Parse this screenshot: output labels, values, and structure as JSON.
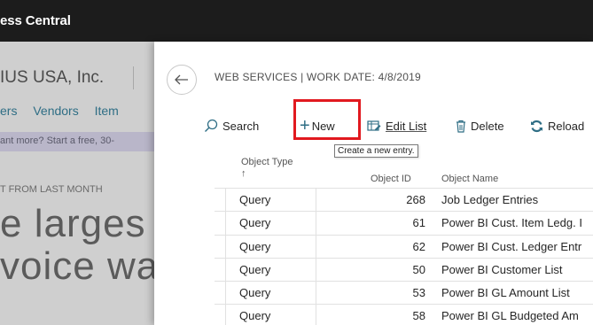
{
  "app": {
    "title": "ess Central"
  },
  "background": {
    "company": "IUS USA, Inc.",
    "nav_links": [
      "ers",
      "Vendors",
      "Item"
    ],
    "trial_banner": "ant more? Start a free, 30-",
    "kpi_label": "T FROM LAST MONTH",
    "big_text_line1": "e larges",
    "big_text_line2": "voice wa"
  },
  "panel": {
    "back_icon": "back-arrow-icon",
    "breadcrumb": "WEB SERVICES | WORK DATE: 4/8/2019",
    "toolbar": {
      "search_label": "Search",
      "new_label": "New",
      "edit_list_label": "Edit List",
      "delete_label": "Delete",
      "reload_label": "Reload"
    },
    "tooltip": "Create a new entry.",
    "highlight_color": "#e1191f",
    "accent_color": "#2f6e85",
    "columns": {
      "object_type": "Object Type",
      "sort_arrow": "↑",
      "object_id": "Object ID",
      "object_name": "Object Name"
    },
    "rows": [
      {
        "type": "Query",
        "id": "268",
        "name": "Job Ledger Entries"
      },
      {
        "type": "Query",
        "id": "61",
        "name": "Power BI Cust. Item Ledg. I"
      },
      {
        "type": "Query",
        "id": "62",
        "name": "Power BI Cust. Ledger Entr"
      },
      {
        "type": "Query",
        "id": "50",
        "name": "Power BI Customer List"
      },
      {
        "type": "Query",
        "id": "53",
        "name": "Power BI GL Amount List"
      },
      {
        "type": "Query",
        "id": "58",
        "name": "Power BI GL Budgeted Am"
      }
    ]
  }
}
